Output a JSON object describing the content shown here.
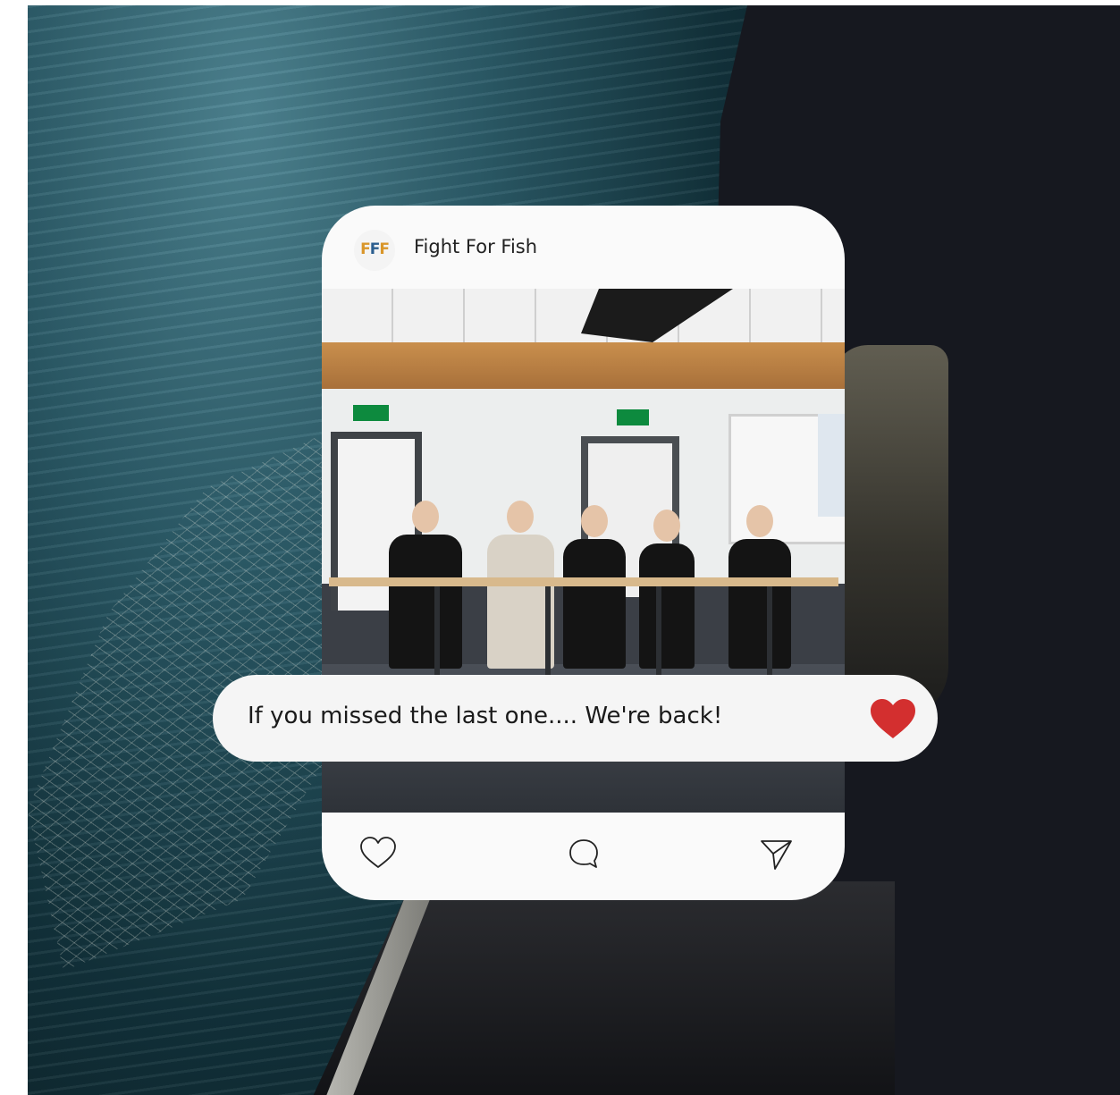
{
  "post": {
    "account_name": "Fight For Fish",
    "avatar_logo_letters": [
      "F",
      "F",
      "F"
    ],
    "caption": "If you missed the last one.... We're back!",
    "actions": {
      "like_icon": "heart-outline-icon",
      "comment_icon": "comment-bubble-icon",
      "share_icon": "paper-plane-icon"
    },
    "caption_icon": "heart-filled-icon"
  },
  "colors": {
    "heart": "#d32f2f",
    "card": "#fafafa",
    "caption_bubble": "#f5f5f5"
  }
}
